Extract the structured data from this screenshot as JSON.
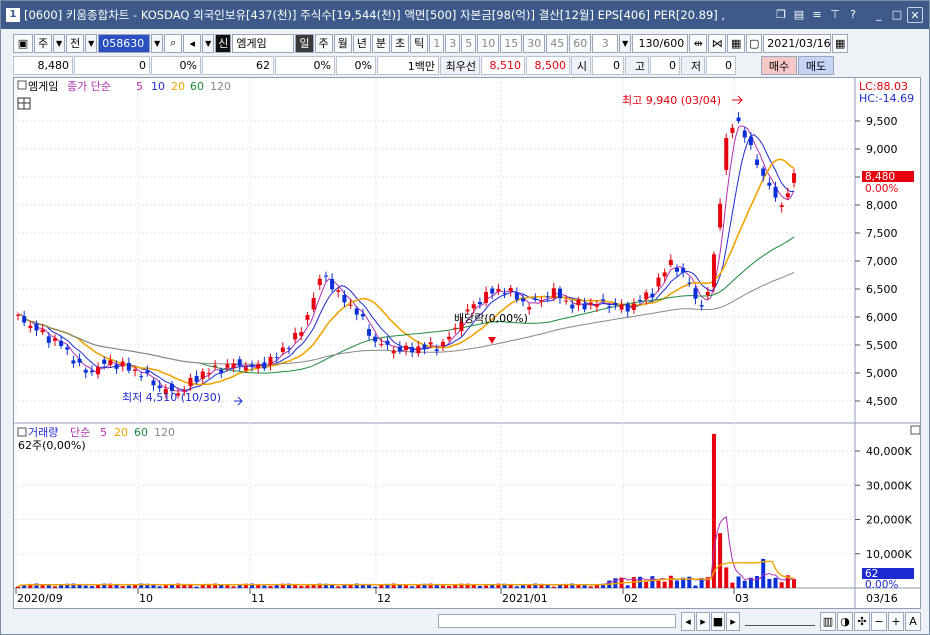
{
  "window": {
    "title": "[0600] 키움종합차트 - KOSDAQ 외국인보유[437(천)] 주식수[19,544(천)] 액면[500] 자본금[98(억)] 결산[12월] EPS[406] PER[20.89] ,",
    "num": "1"
  },
  "toolbar": {
    "type1": "주",
    "type2": "전",
    "code": "058630",
    "badge": "신",
    "name": "엠게임",
    "periods": [
      "일",
      "주",
      "월",
      "년",
      "분",
      "초",
      "틱"
    ],
    "minutes": [
      "1",
      "3",
      "5",
      "10",
      "15",
      "30",
      "45",
      "60"
    ],
    "nval": "3",
    "count": "130/600",
    "date": "2021/03/16"
  },
  "quote": {
    "price": "8,480",
    "change": "0",
    "pct1": "0%",
    "volume": "62",
    "pct2": "0%",
    "pct3": "0%",
    "unit": "1백만",
    "priority": "최우선",
    "bid": "8,510",
    "ask": "8,500",
    "open_lbl": "시",
    "open": "0",
    "high_lbl": "고",
    "high": "0",
    "low_lbl": "저",
    "low": "0",
    "buy": "매수",
    "sell": "매도"
  },
  "price_legend": {
    "name": "엠게임",
    "ma_label": "종가 단순",
    "ma": [
      "5",
      "10",
      "20",
      "60",
      "120"
    ]
  },
  "price_annotations": {
    "lc": "LC:88.03",
    "hc": "HC:-14.69",
    "high": "최고 9,940 (03/04)",
    "low": "최저 4,510 (10/30)",
    "dividend": "배당락(0,00%)",
    "last_price": "8,480",
    "last_pct": "0.00%"
  },
  "price_axis": [
    "9,500",
    "9,000",
    "8,500",
    "8,000",
    "7,500",
    "7,000",
    "6,500",
    "6,000",
    "5,500",
    "5,000",
    "4,500"
  ],
  "volume_legend": {
    "label": "거래량",
    "ma_label": "단순",
    "ma": [
      "5",
      "20",
      "60",
      "120"
    ],
    "value": "62주(0,00%)"
  },
  "volume_axis": [
    "40,000K",
    "30,000K",
    "20,000K",
    "10,000K"
  ],
  "volume_annotations": {
    "last": "62",
    "last_pct": "0.00%"
  },
  "date_axis": [
    "2020/09",
    "10",
    "11",
    "12",
    "2021/01",
    "02",
    "03"
  ],
  "date_right": "03/16",
  "colors": {
    "up": "#e8000f",
    "down": "#0a2fd8",
    "ma5": "#b030b0",
    "ma10": "#1e2bd0",
    "ma20": "#f0a400",
    "ma60": "#1c8a3c",
    "ma120": "#888888",
    "title": "#3d5a8a"
  },
  "chart_data": {
    "type": "candlestick",
    "x_start": "2020/09",
    "x_end": "2021/03/16",
    "high": {
      "value": 9940,
      "date": "03/04"
    },
    "low": {
      "value": 4510,
      "date": "10/30"
    },
    "last_close": 8480,
    "ylim": [
      4250,
      9900
    ],
    "volume_ylim": [
      0,
      47000
    ],
    "volume_unit": "K"
  }
}
